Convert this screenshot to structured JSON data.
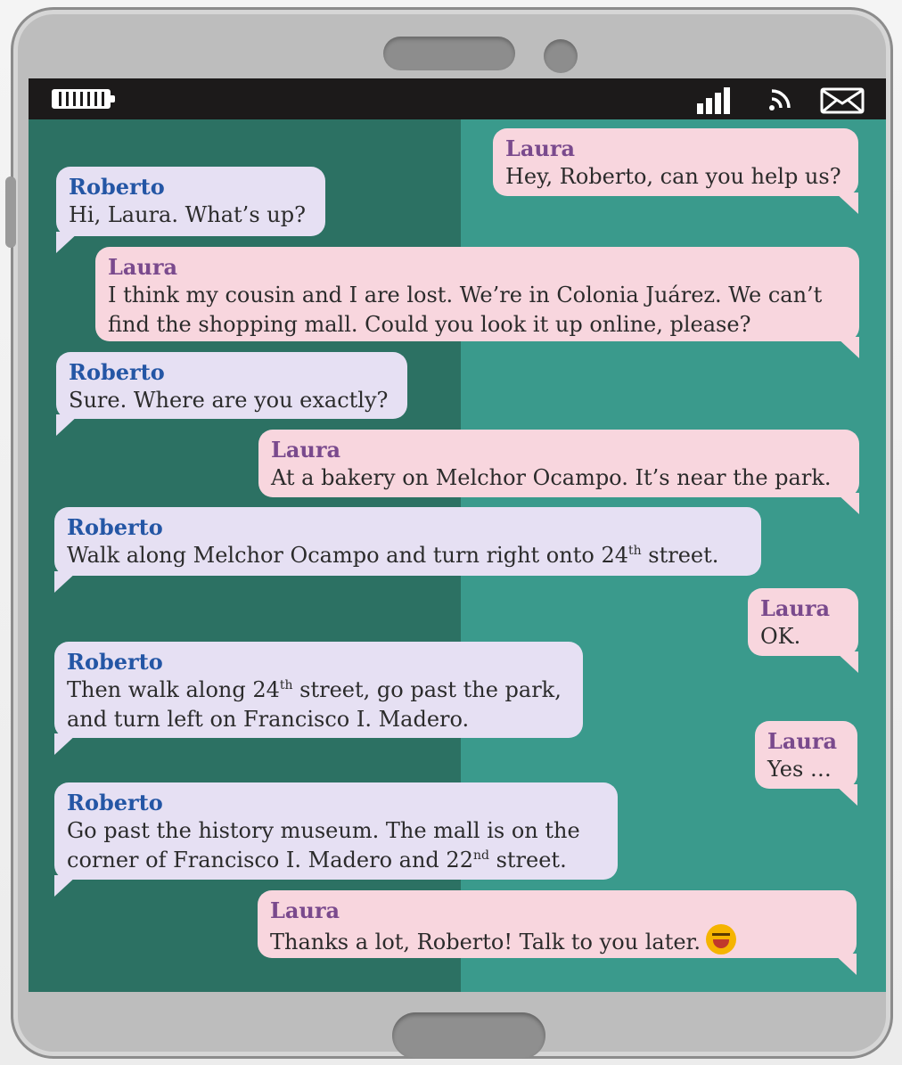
{
  "status_bar": {
    "icons": [
      "battery-icon",
      "signal-icon",
      "wifi-icon",
      "mail-icon"
    ]
  },
  "colors": {
    "roberto_bubble": "#e6e0f3",
    "laura_bubble": "#f8d6de",
    "roberto_name": "#2456a5",
    "laura_name": "#7a4a8d",
    "screen": "#2e7a6c"
  },
  "messages": [
    {
      "sender": "Laura",
      "text": "Hey, Roberto, can you help us?"
    },
    {
      "sender": "Roberto",
      "text": "Hi, Laura. What’s up?"
    },
    {
      "sender": "Laura",
      "lines": [
        "I think my cousin and I are lost. We’re in Colonia Juárez. We can’t",
        "find the shopping mall. Could you look it up online, please?"
      ]
    },
    {
      "sender": "Roberto",
      "text": "Sure. Where are you exactly?"
    },
    {
      "sender": "Laura",
      "text": "At a bakery on Melchor Ocampo. It’s near the park."
    },
    {
      "sender": "Roberto",
      "text_before": "Walk along Melchor Ocampo and turn right onto 24",
      "sup": "th",
      "text_after": " street."
    },
    {
      "sender": "Laura",
      "text": "OK."
    },
    {
      "sender": "Roberto",
      "line1_before": "Then walk along 24",
      "line1_sup": "th",
      "line1_after": " street, go past the park,",
      "line2": "and turn left on Francisco I. Madero."
    },
    {
      "sender": "Laura",
      "text": "Yes …"
    },
    {
      "sender": "Roberto",
      "line1": "Go past the history museum. The mall is on the",
      "line2_before": "corner of Francisco I. Madero and 22",
      "line2_sup": "nd",
      "line2_after": " street."
    },
    {
      "sender": "Laura",
      "text": "Thanks a lot, Roberto! Talk to you later.",
      "emoji": "grinning-face-emoji"
    }
  ]
}
